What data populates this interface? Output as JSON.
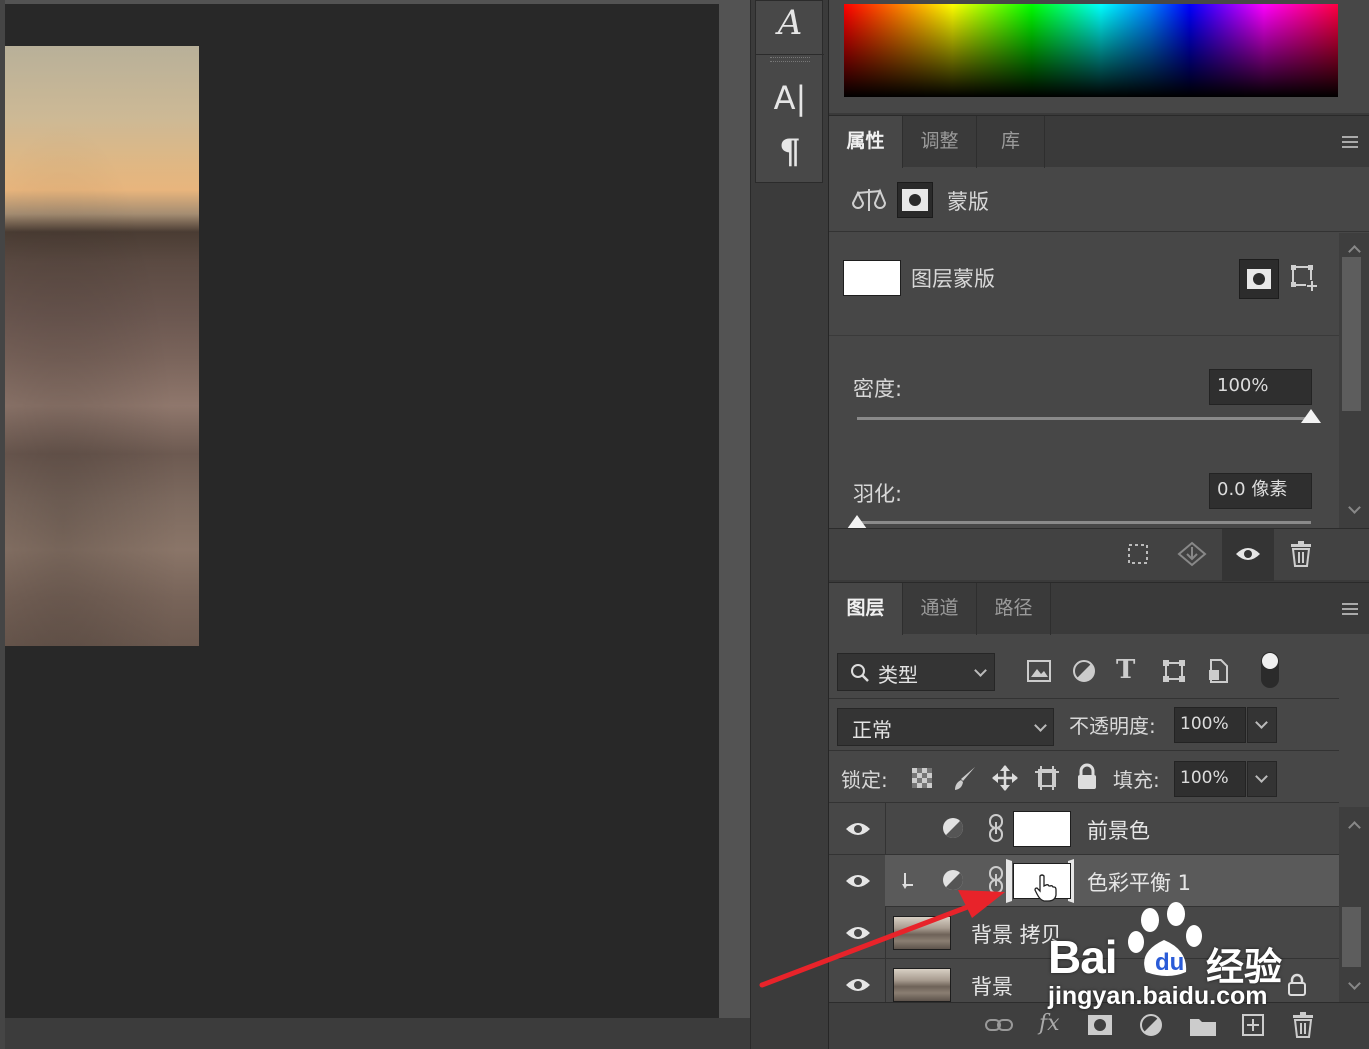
{
  "tool_strip": {
    "text_style_icon": "A",
    "char_icon": "A|",
    "paragraph_icon": "¶"
  },
  "properties_panel": {
    "tabs": [
      {
        "label": "属性",
        "active": true
      },
      {
        "label": "调整",
        "active": false
      },
      {
        "label": "库",
        "active": false
      }
    ],
    "header_title": "蒙版",
    "layer_mask_label": "图层蒙版",
    "density_label": "密度:",
    "density_value": "100%",
    "density_level": 1.0,
    "feather_label": "羽化:",
    "feather_value": "0.0 像素",
    "feather_level": 0.0
  },
  "layers_panel": {
    "tabs": [
      {
        "label": "图层",
        "active": true
      },
      {
        "label": "通道",
        "active": false
      },
      {
        "label": "路径",
        "active": false
      }
    ],
    "filter_kind": "类型",
    "blend_mode": "正常",
    "opacity_label": "不透明度:",
    "opacity_value": "100%",
    "lock_label": "锁定:",
    "fill_label": "填充:",
    "fill_value": "100%",
    "layers": [
      {
        "name": "前景色",
        "visible": true,
        "selected": false
      },
      {
        "name": "色彩平衡 1",
        "visible": true,
        "selected": true
      },
      {
        "name": "背景 拷贝",
        "visible": true,
        "selected": false
      },
      {
        "name": "背景",
        "visible": true,
        "selected": false
      }
    ],
    "footer_fx": "fx"
  },
  "watermark": {
    "brand": "Bai",
    "brand_cn": "经验",
    "url": "jingyan.baidu.com"
  },
  "colors": {
    "panel_bg": "#474747",
    "selected_layer": "#5a5a5a",
    "arrow": "#e8232a"
  }
}
